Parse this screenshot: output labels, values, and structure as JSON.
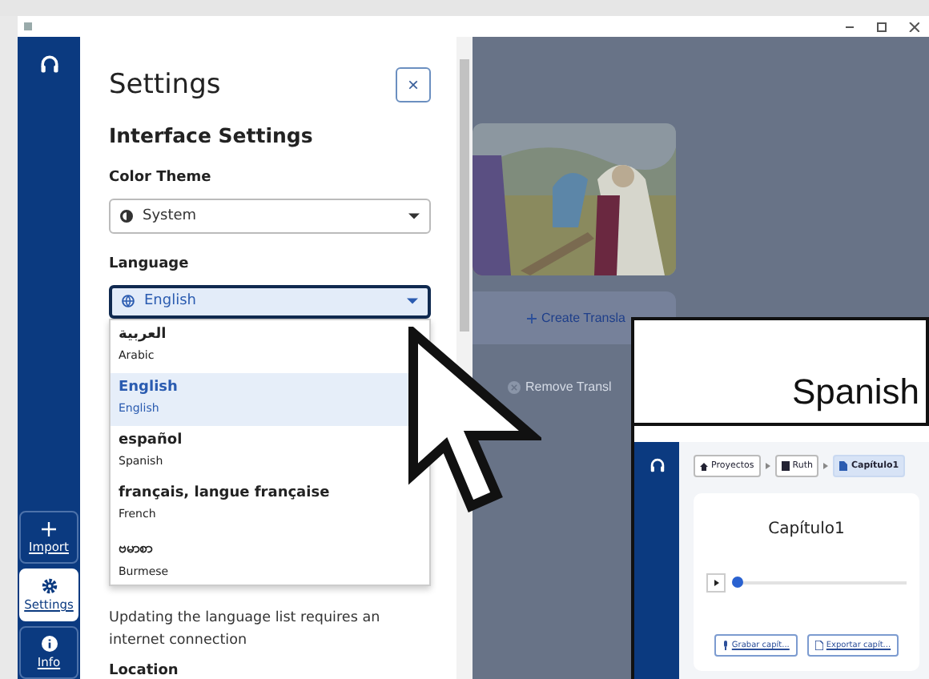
{
  "sidebar": {
    "items": [
      {
        "kind": "import",
        "label": "Import",
        "selected": false
      },
      {
        "kind": "settings",
        "label": "Settings",
        "selected": true
      },
      {
        "kind": "info",
        "label": "Info",
        "selected": false
      }
    ]
  },
  "settings": {
    "title": "Settings",
    "close": "×",
    "section": "Interface Settings",
    "color_theme": {
      "label": "Color Theme",
      "value": "System"
    },
    "language": {
      "label": "Language",
      "value": "English",
      "expanded": true,
      "options": [
        {
          "name": "العربية",
          "english": "Arabic",
          "selected": false
        },
        {
          "name": "English",
          "english": "English",
          "selected": true
        },
        {
          "name": "español",
          "english": "Spanish",
          "selected": false
        },
        {
          "name": "français, langue française",
          "english": "French",
          "selected": false
        },
        {
          "name": "ဗမာစာ",
          "english": "Burmese",
          "selected": false
        }
      ]
    },
    "note": "Updating the language list requires an internet connection",
    "next_label": "Location"
  },
  "background": {
    "create_button": "Create Transla",
    "remove_button": "Remove Transl"
  },
  "callout": "Spanish",
  "inset": {
    "breadcrumbs": [
      {
        "label": "Proyectos",
        "kind": "home",
        "selected": false
      },
      {
        "label": "Ruth",
        "kind": "book",
        "selected": false
      },
      {
        "label": "Capítulo1",
        "kind": "file",
        "selected": true
      }
    ],
    "card_title": "Capítulo1",
    "player": {
      "level": 0.03
    },
    "buttons": [
      {
        "kind": "mic",
        "label": "Grabar capít..."
      },
      {
        "kind": "file",
        "label": "Exportar capít..."
      }
    ]
  }
}
